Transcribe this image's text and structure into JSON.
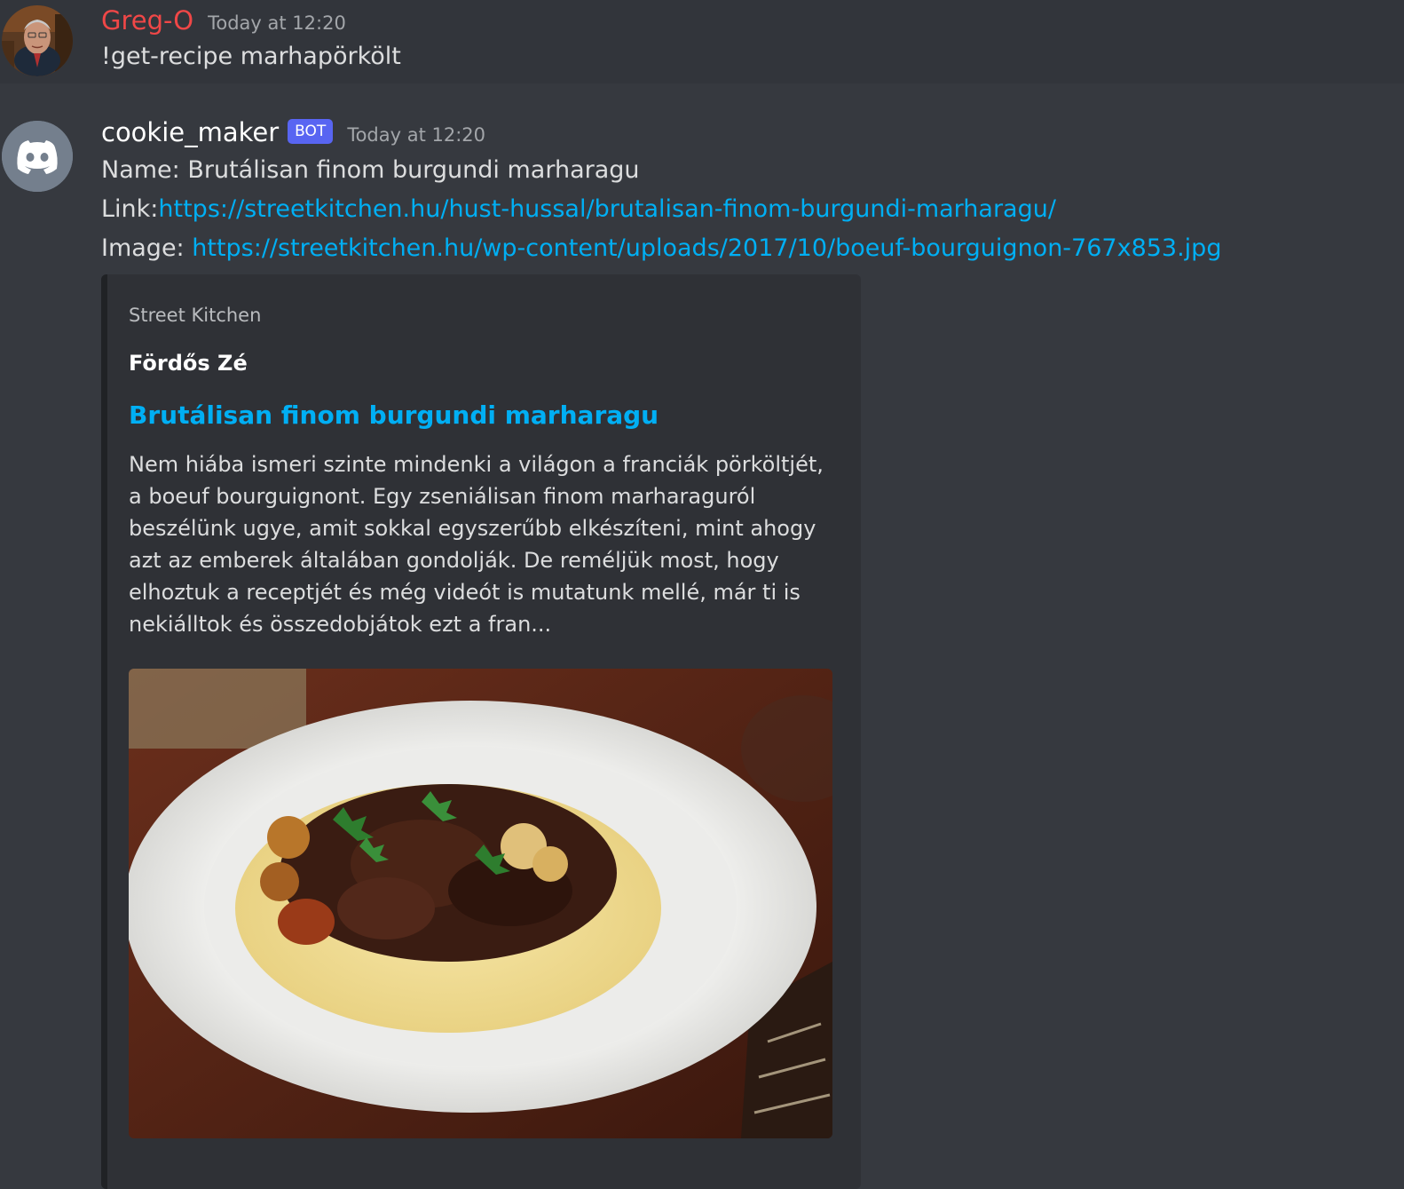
{
  "messages": {
    "greg": {
      "username": "Greg-O",
      "timestamp": "Today at 12:20",
      "content": "!get-recipe marhapörkölt"
    },
    "bot": {
      "username": "cookie_maker",
      "bot_tag": "BOT",
      "timestamp": "Today at 12:20",
      "name_label": "Name: ",
      "name_value": "Brutálisan finom burgundi marharagu",
      "link_label": "Link:",
      "link_url": "https://streetkitchen.hu/hust-hussal/brutalisan-finom-burgundi-marharagu/",
      "image_label": "Image: ",
      "image_url": "https://streetkitchen.hu/wp-content/uploads/2017/10/boeuf-bourguignon-767x853.jpg",
      "embed": {
        "provider": "Street Kitchen",
        "author": "Fördős Zé",
        "title": "Brutálisan finom burgundi marharagu",
        "description": "Nem hiába ismeri szinte mindenki a világon a franciák pörköltjét, a boeuf bourguignont. Egy zseniálisan finom marharaguról beszélünk ugye, amit sokkal egyszerűbb elkészíteni, mint ahogy azt az emberek általában gondolják. De reméljük most, hogy elhoztuk a receptjét és még videót is mutatunk mellé, már ti is nekiálltok és összedobjátok ezt a fran...",
        "image_icon": "beef-stew-on-mashed-potatoes-image"
      }
    }
  },
  "colors": {
    "background": "#36393f",
    "highlight_row": "#32353b",
    "embed_bg": "#2f3136",
    "link": "#00aff4",
    "greg_name": "#f04747",
    "bot_tag": "#5865f2",
    "discord_avatar": "#747f8d"
  },
  "icons": {
    "greg_avatar": "user-photo-avatar",
    "bot_avatar": "discord-logo-icon"
  }
}
